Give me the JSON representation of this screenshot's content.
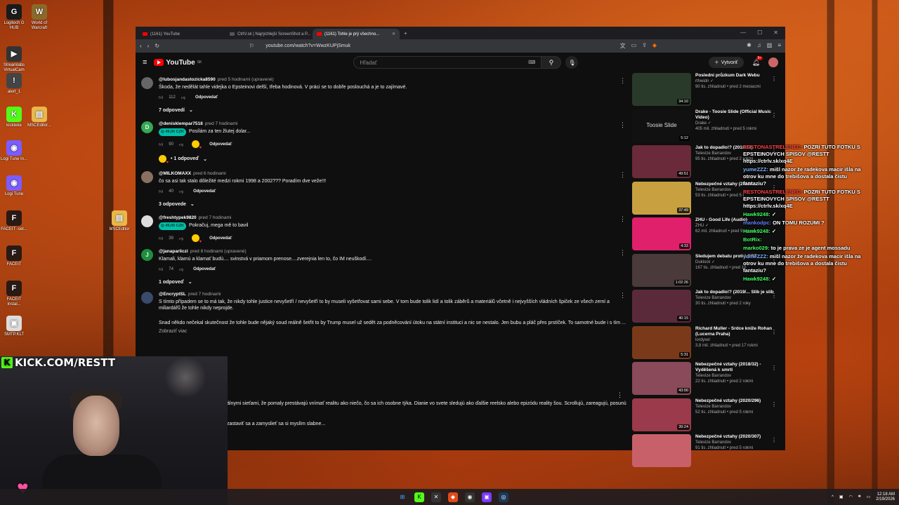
{
  "desktop_icons": [
    {
      "label": "Logitech G HUB",
      "glyph": "G",
      "color": "#1a1a1a"
    },
    {
      "label": "World of Warcraft",
      "glyph": "W",
      "color": "#8a6a2a"
    },
    {
      "label": "Streamlabs VirtualCam",
      "glyph": "▶",
      "color": "#333"
    },
    {
      "label": "alert_1",
      "glyph": "!",
      "color": "#444"
    },
    {
      "label": "kickteke",
      "glyph": "K",
      "color": "#53fc18"
    },
    {
      "label": "MSCEditor...",
      "glyph": "▤",
      "color": "#e8b84a"
    },
    {
      "label": "Logi Tune In...",
      "glyph": "◉",
      "color": "#7a5cff"
    },
    {
      "label": "Logi Tune",
      "glyph": "◉",
      "color": "#7a5cff"
    },
    {
      "label": "MSCEditor",
      "glyph": "▤",
      "color": "#e8b84a"
    },
    {
      "label": "FACEIT -set...",
      "glyph": "F",
      "color": "#2a1a14"
    },
    {
      "label": "FACEIT",
      "glyph": "F",
      "color": "#2a1a14"
    },
    {
      "label": "FACEIT Instal...",
      "glyph": "F",
      "color": "#2a1a14"
    },
    {
      "label": "SMTP.KLT",
      "glyph": "▣",
      "color": "#ddd"
    }
  ],
  "browser": {
    "tabs": [
      {
        "label": "(1161) YouTube"
      },
      {
        "label": "CtrlV.sk | Najrýchlejší ScreenShot a P..."
      },
      {
        "label": "(1161) Tohle je prý všechno..."
      }
    ],
    "url": "youtube.com/watch?v=WwzKUPjSmuk"
  },
  "youtube": {
    "logo": "YouTube",
    "logo_sup": "SK",
    "search_placeholder": "Hľadať",
    "create_label": "Vytvoriť",
    "notif_count": "9+"
  },
  "comments": [
    {
      "author": "@lubosjandastozicka8590",
      "time": "pred 5 hodinami (upravené)",
      "text": "Škoda, že nedělát tahle videjka o Epsteinovi delší, třeba hodinová. V práci se to dobře poslouchá a je to zajímavé.",
      "likes": "112",
      "reply": "Odpovedať",
      "replies": "7 odpovedí",
      "avatar_color": "#666",
      "avatar_glyph": ""
    },
    {
      "author": "@denisklempar7518",
      "time": "pred 7 hodinami",
      "superchat": "49,00 CZK",
      "text": "Posílám za ten žlutej dolar...",
      "likes": "90",
      "reply": "Odpovedať",
      "replies": "1 odpoveď",
      "avatar_color": "#34a853",
      "avatar_glyph": "D"
    },
    {
      "author": "@MILKOMAXX",
      "time": "pred 6 hodinami",
      "text": "čo sa asi tak stalo dôležité medzi rokmi 1998 a 2002??? Poradím dve veže!!!",
      "likes": "40",
      "reply": "Odpovedať",
      "replies": "3 odpovede",
      "avatar_color": "#8a7060",
      "avatar_glyph": ""
    },
    {
      "author": "@freshtypek9820",
      "time": "pred 7 hodinami",
      "superchat": "49,00 CZK",
      "text": "Pokračuj, mega mě to bavil",
      "likes": "39",
      "reply": "Odpovedať",
      "replies": "",
      "avatar_color": "#ddd",
      "avatar_glyph": ""
    },
    {
      "author": "@janaparliczi",
      "time": "pred 8 hodinami (upravené)",
      "text": "Klamali, klamú a klamať budú.... svinstvá v priamom prenose....zverejnia len to, čo IM neuškodí....",
      "likes": "74",
      "reply": "Odpovedať",
      "replies": "1 odpoveď",
      "avatar_color": "#1e8e3e",
      "avatar_glyph": "J"
    },
    {
      "author": "@EncryptSL",
      "time": "pred 7 hodinami",
      "text": "S tímto případem se to má tak, že nikdy tohle justice nevyšetří / nevyšetří to by museli vyšetřovat sami sebe. V tom bude tolik lidí a tolik záběrů a materiálů včetně i nejvyšších vládních špiček ze všech zemí a miliardářů že tohle nikdy neprojde.",
      "text2": "Snad někdo nečekal skutečnost že tohle bude nějaký soud reálně šetřit to by Trump musel už sedět za podněcování útoku na státní instituci a nic se nestalo. Jen bubu a pláč přes prstíček. To samotné bude i s tím ...",
      "more": "Zobraziť viac",
      "avatar_color": "#3a4a6a",
      "avatar_glyph": ""
    }
  ],
  "partial_comment": {
    "line1": "álnymi sieťami, že pomaly prestávajú vnímať realitu ako niečo, čo sa ich osobne týka. Dianie vo svete sledujú ako ďalšie reelsko alebo epizódu reality šou. Scrollujú, zareagujú, posunú",
    "line2": "zastaviť sa a zamyslieť sa si myslím slabne..."
  },
  "sidebar_videos": [
    {
      "title": "Posledni průzkum Dark Webu",
      "channel": "rthwidn ✓",
      "meta": "90 tis. zhliadnutí • pred 2 mesiacmi",
      "duration": "34:10",
      "thumb": "#2a3a2a"
    },
    {
      "title": "Drake - Toosie Slide (Official Music Video)",
      "channel": "Drake ✓",
      "meta": "405 mil. zhliadnutí • pred 5 rokmi",
      "duration": "5:12",
      "thumb": "#111",
      "thumb_text": "Toosie Slide"
    },
    {
      "title": "Jak to dopadlo!? (2018/14)",
      "channel": "Televize Barrandov",
      "meta": "95 tis. zhliadnutí • pred 2 rokmi",
      "duration": "49:51",
      "thumb": "#6a2a3a"
    },
    {
      "title": "Nebezpečné vztahy (2018/...",
      "channel": "Televize Barrandov",
      "meta": "53 tis. zhliadnutí • pred 5 r",
      "duration": "37:49",
      "thumb": "#c8a040"
    },
    {
      "title": "ZHU - Good Life (Audio)",
      "channel": "ZHU ✓",
      "meta": "62 mil. zhliadnutí • pred 9 rokmi",
      "duration": "4:33",
      "thumb": "#e0206a"
    },
    {
      "title": "Sledujem debatu proti LGBT",
      "channel": "Duklock ✓",
      "meta": "167 tis. zhliadnutí • pred 10",
      "duration": "1:02:26",
      "thumb": "#4a3a3a"
    },
    {
      "title": "Jak to dopadlo!? (2019/... Slib je slib",
      "channel": "Televize Barrandov",
      "meta": "30 tis. zhliadnutí • pred 2 roky",
      "duration": "40:15",
      "thumb": "#5a2a3a"
    },
    {
      "title": "Richard Muller - Srdce kníže Rohan (Lucerna Praha)",
      "channel": "lordyxel",
      "meta": "3,8 mil. zhliadnutí • pred 17 rokmi",
      "duration": "5:31",
      "thumb": "#7a3a1a"
    },
    {
      "title": "Nebezpečné vztahy (2018/32) - Vyděšená k smrti",
      "channel": "Televize Barrandov",
      "meta": "22 tis. zhliadnutí • pred 2 rokmi",
      "duration": "43:00",
      "thumb": "#8a4a5a"
    },
    {
      "title": "Nebezpečné vztahy (2020/296)",
      "channel": "Televize Barrandov",
      "meta": "52 tis. zhliadnutí • pred 5 rokmi",
      "duration": "39:24",
      "thumb": "#9a3a4a"
    },
    {
      "title": "Nebezpečné vztahy (2020/307)",
      "channel": "Televize Barrandov",
      "meta": "91 tis. zhliadnutí • pred 5 rokmi",
      "duration": "",
      "thumb": "#c8606a"
    }
  ],
  "chat": [
    {
      "user": "RESTONASTRELENEC:",
      "user_color": "#ff4040",
      "text": "POZRI TUTO FOTKU S EPSTEINOVYCH SPISOV @RESTT https://ctrlv.sk/xq4E"
    },
    {
      "user": "yumeZZZ:",
      "user_color": "#80b0ff",
      "text": "mišl nazor že radekova macir išla na otrov ku mne do trebišova a dostala čistu fantaziu?"
    },
    {
      "user": "RESTONASTRELENEC:",
      "user_color": "#ff4040",
      "text": "POZRI TUTO FOTKU S EPSTEINOVYCH SPISOV @RESTT https://ctrlv.sk/xq4E"
    },
    {
      "user": "Hawk9248:",
      "user_color": "#40ff60",
      "text": "✓"
    },
    {
      "user": "mankodpc:",
      "user_color": "#6080ff",
      "text": "ON TOMU ROZUMI ?"
    },
    {
      "user": "Hawk9248:",
      "user_color": "#40ff60",
      "text": "✓"
    },
    {
      "user": "BotRix:",
      "user_color": "#40ff60",
      "text": ""
    },
    {
      "user": "marko029:",
      "user_color": "#40ff60",
      "text": "to je prava ze je agent mossadu"
    },
    {
      "user": "yumeZZZ:",
      "user_color": "#80b0ff",
      "text": "mišl nazor že radekova macir išla na otrov ku mne do trebišova a dostala čistu fantaziu?"
    },
    {
      "user": "Hawk9248:",
      "user_color": "#40ff60",
      "text": "✓"
    }
  ],
  "overlay": {
    "kick_text": "KICK.COM/RESTT"
  },
  "taskbar": {
    "time": "12:18 AM",
    "date": "2/19/2026"
  }
}
